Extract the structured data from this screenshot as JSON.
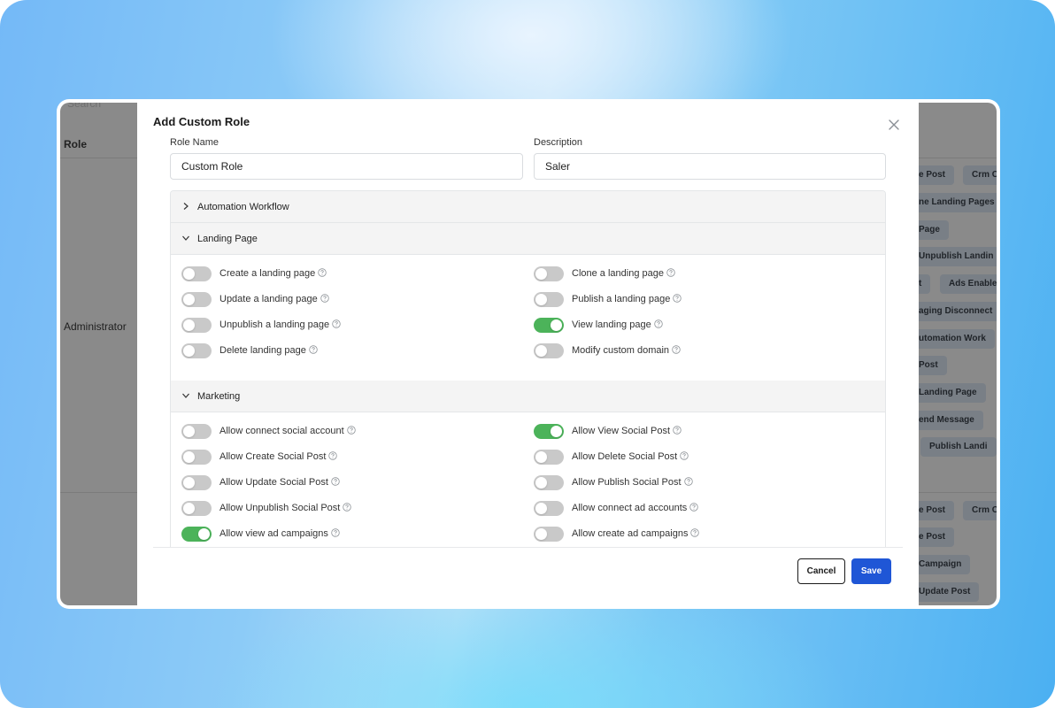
{
  "background_app": {
    "search_placeholder": "Search",
    "role_column_header": "Role",
    "role_row_name": "Administrator",
    "permission_tags": [
      "e Post",
      "Crm C",
      "ne Landing Pages",
      "Page",
      "Unpublish Landin",
      "t",
      "Ads Enable",
      "aging Disconnect",
      "utomation Work",
      "Post",
      "Landing Page",
      "end Message",
      "Publish Landi",
      "e Post",
      "Crm C",
      "e Post",
      "Campaign",
      "Update Post"
    ]
  },
  "modal": {
    "title": "Add Custom Role",
    "role_name": {
      "label": "Role Name",
      "value": "Custom Role"
    },
    "description": {
      "label": "Description",
      "value": "Saler"
    },
    "sections": [
      {
        "title": "Automation Workflow",
        "expanded": false,
        "permissions": []
      },
      {
        "title": "Landing Page",
        "expanded": true,
        "permissions": [
          {
            "label": "Create a landing page",
            "enabled": false
          },
          {
            "label": "Clone a landing page",
            "enabled": false
          },
          {
            "label": "Update a landing page",
            "enabled": false
          },
          {
            "label": "Publish a landing page",
            "enabled": false
          },
          {
            "label": "Unpublish a landing page",
            "enabled": false
          },
          {
            "label": "View landing page",
            "enabled": true
          },
          {
            "label": "Delete landing page",
            "enabled": false
          },
          {
            "label": "Modify custom domain",
            "enabled": false
          }
        ]
      },
      {
        "title": "Marketing",
        "expanded": true,
        "permissions": [
          {
            "label": "Allow connect social account",
            "enabled": false
          },
          {
            "label": "Allow View Social Post",
            "enabled": true
          },
          {
            "label": "Allow Create Social Post",
            "enabled": false
          },
          {
            "label": "Allow Delete Social Post",
            "enabled": false
          },
          {
            "label": "Allow Update Social Post",
            "enabled": false
          },
          {
            "label": "Allow Publish Social Post",
            "enabled": false
          },
          {
            "label": "Allow Unpublish Social Post",
            "enabled": false
          },
          {
            "label": "Allow connect ad accounts",
            "enabled": false
          },
          {
            "label": "Allow view ad campaigns",
            "enabled": true
          },
          {
            "label": "Allow create ad campaigns",
            "enabled": false
          }
        ]
      }
    ],
    "buttons": {
      "cancel": "Cancel",
      "save": "Save"
    }
  },
  "colors": {
    "toggle_on": "#4cb35a",
    "toggle_off": "#c9c9c9",
    "primary": "#1f56d6"
  },
  "icons": {
    "close": "close-icon",
    "collapsed_section": "chevron-right-icon",
    "expanded_section": "chevron-down-icon",
    "help": "question-circle-icon"
  }
}
